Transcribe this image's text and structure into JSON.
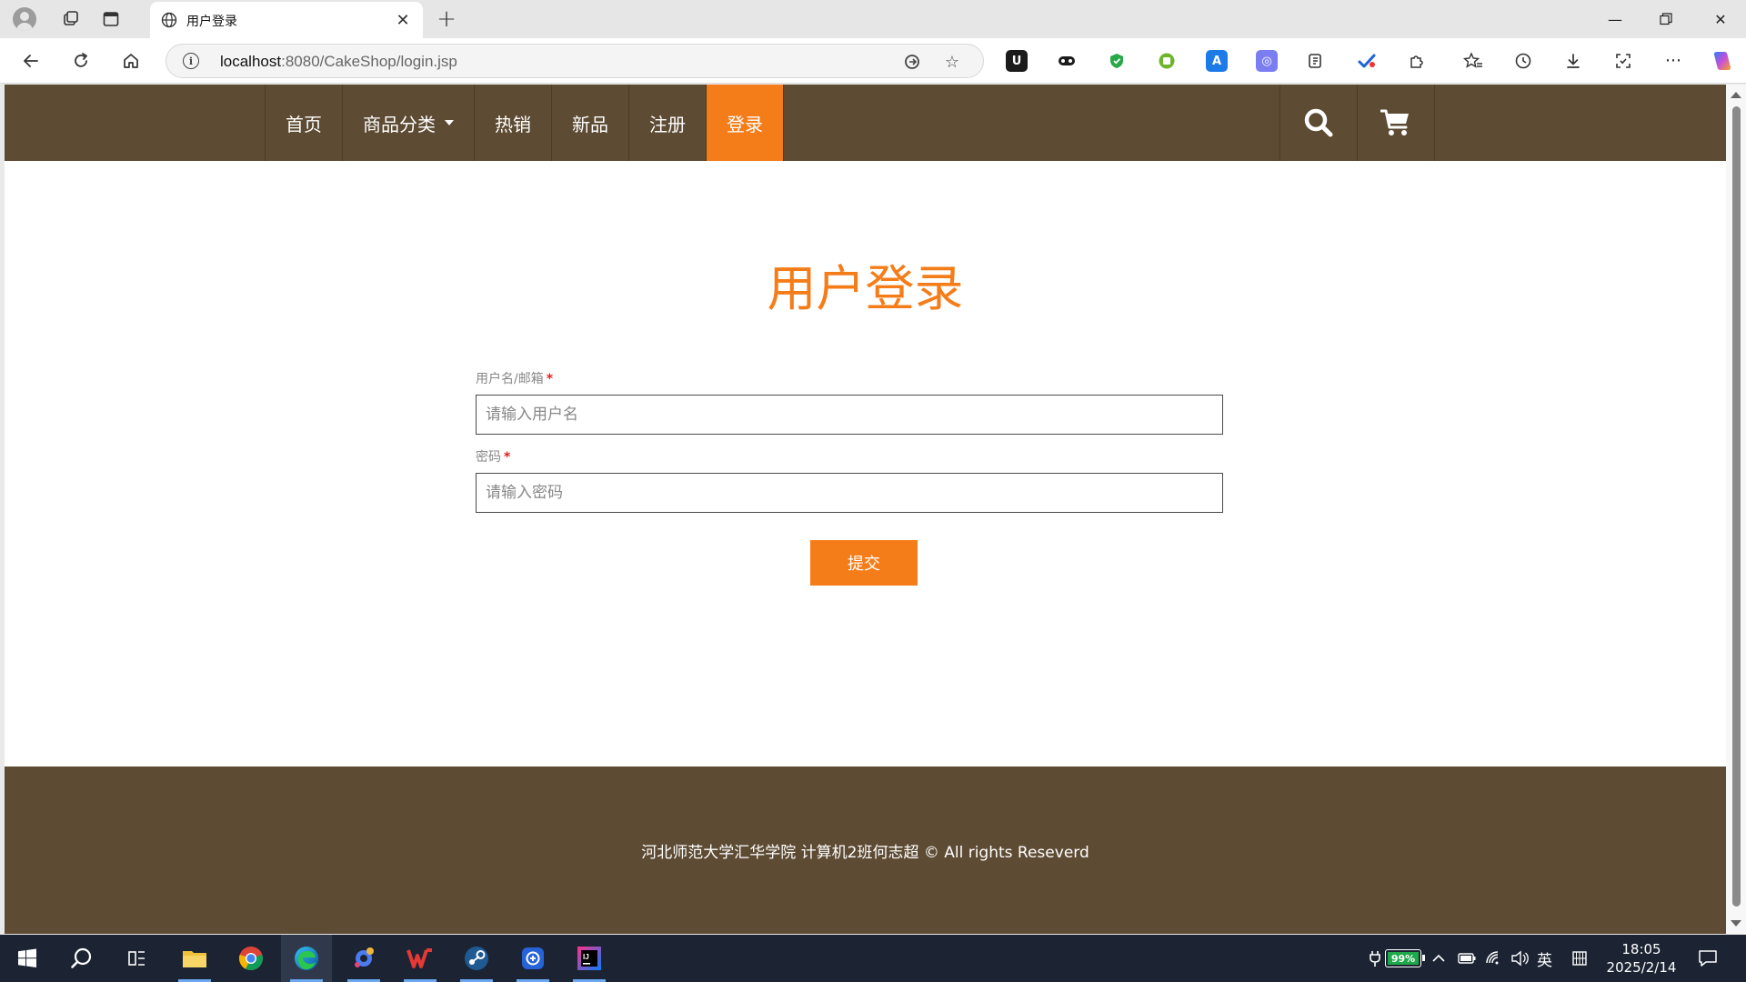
{
  "browser": {
    "tab_title": "用户登录",
    "url_host": "localhost",
    "url_rest": ":8080/CakeShop/login.jsp"
  },
  "site": {
    "nav": {
      "items": [
        {
          "label": "首页",
          "active": false,
          "dropdown": false
        },
        {
          "label": "商品分类",
          "active": false,
          "dropdown": true
        },
        {
          "label": "热销",
          "active": false,
          "dropdown": false
        },
        {
          "label": "新品",
          "active": false,
          "dropdown": false
        },
        {
          "label": "注册",
          "active": false,
          "dropdown": false
        },
        {
          "label": "登录",
          "active": true,
          "dropdown": false
        }
      ],
      "icons": [
        "search-icon",
        "cart-icon"
      ]
    },
    "login": {
      "title": "用户登录",
      "username_label": "用户名/邮箱",
      "username_placeholder": "请输入用户名",
      "username_value": "",
      "password_label": "密码",
      "password_placeholder": "请输入密码",
      "password_value": "",
      "required_mark": "*",
      "submit_label": "提交"
    },
    "footer": {
      "copyright": "河北师范大学汇华学院 计算机2班何志超 © All rights Reseverd"
    }
  },
  "taskbar": {
    "battery_percent": "99%",
    "ime_lang": "英",
    "time": "18:05",
    "date": "2025/2/14"
  },
  "colors": {
    "nav_bg": "#5d4b33",
    "accent": "#f47d1a",
    "required": "#e21f1f",
    "footer_bg": "#5d4b33"
  }
}
